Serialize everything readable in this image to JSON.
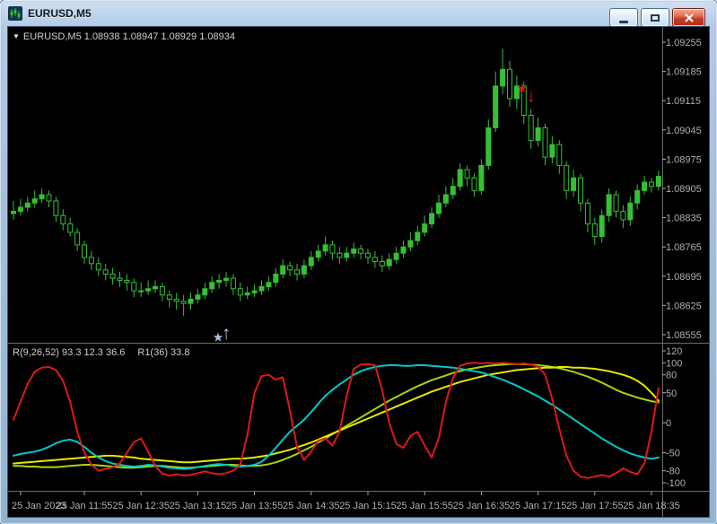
{
  "window": {
    "title": "EURUSD,M5"
  },
  "chart": {
    "ohlc_triangle": "▼",
    "symbol_line": "EURUSD,M5 1.08938 1.08947 1.08929 1.08934",
    "indicator_label_1": "R(9,26,52) 93.3 12.3 36.6",
    "indicator_label_2": "R1(36) 33.8"
  },
  "colors": {
    "background": "#000000",
    "candle": "#35c035",
    "axis_text": "#b0b0b0",
    "separator": "#6e6e6e",
    "up_arrow": "#a6c5e6",
    "down_arrow": "#e01212"
  },
  "chart_data": {
    "type": "candlestick",
    "symbol": "EURUSD",
    "timeframe": "M5",
    "price_axis": [
      1.09255,
      1.09185,
      1.09115,
      1.09045,
      1.08975,
      1.08905,
      1.08835,
      1.08765,
      1.08695,
      1.08625,
      1.08555
    ],
    "time_axis": [
      {
        "index": 1,
        "label": "25 Jan 2023"
      },
      {
        "index": 10,
        "label": "25 Jan 11:55"
      },
      {
        "index": 18,
        "label": "25 Jan 12:35"
      },
      {
        "index": 26,
        "label": "25 Jan 13:15"
      },
      {
        "index": 34,
        "label": "25 Jan 13:55"
      },
      {
        "index": 42,
        "label": "25 Jan 14:35"
      },
      {
        "index": 50,
        "label": "25 Jan 15:15"
      },
      {
        "index": 58,
        "label": "25 Jan 15:55"
      },
      {
        "index": 66,
        "label": "25 Jan 16:35"
      },
      {
        "index": 74,
        "label": "25 Jan 17:15"
      },
      {
        "index": 82,
        "label": "25 Jan 17:55"
      },
      {
        "index": 90,
        "label": "25 Jan 18:35"
      }
    ],
    "candles": [
      [
        1.08845,
        1.08875,
        1.0883,
        1.0885
      ],
      [
        1.0885,
        1.0888,
        1.0884,
        1.0886
      ],
      [
        1.0886,
        1.08885,
        1.0885,
        1.0887
      ],
      [
        1.0887,
        1.089,
        1.0886,
        1.0888
      ],
      [
        1.0888,
        1.08905,
        1.0887,
        1.0889
      ],
      [
        1.0889,
        1.089,
        1.0886,
        1.08875
      ],
      [
        1.08875,
        1.08885,
        1.08825,
        1.0884
      ],
      [
        1.0884,
        1.08855,
        1.08805,
        1.0882
      ],
      [
        1.0882,
        1.08835,
        1.0879,
        1.088
      ],
      [
        1.088,
        1.0881,
        1.08755,
        1.0877
      ],
      [
        1.0877,
        1.0878,
        1.08725,
        1.0874
      ],
      [
        1.0874,
        1.08755,
        1.0871,
        1.08725
      ],
      [
        1.08725,
        1.0874,
        1.08695,
        1.0871
      ],
      [
        1.0871,
        1.08725,
        1.08685,
        1.087
      ],
      [
        1.087,
        1.08715,
        1.08675,
        1.0869
      ],
      [
        1.0869,
        1.08705,
        1.0867,
        1.08685
      ],
      [
        1.08685,
        1.087,
        1.0866,
        1.0868
      ],
      [
        1.0868,
        1.0869,
        1.08645,
        1.0866
      ],
      [
        1.0866,
        1.0868,
        1.08645,
        1.0866
      ],
      [
        1.0866,
        1.08685,
        1.0865,
        1.08665
      ],
      [
        1.08665,
        1.08685,
        1.08655,
        1.0867
      ],
      [
        1.0867,
        1.0868,
        1.08635,
        1.0865
      ],
      [
        1.0865,
        1.0866,
        1.0862,
        1.0864
      ],
      [
        1.0864,
        1.08655,
        1.08615,
        1.08635
      ],
      [
        1.08635,
        1.0865,
        1.086,
        1.0863
      ],
      [
        1.0863,
        1.08655,
        1.08615,
        1.0864
      ],
      [
        1.0864,
        1.08665,
        1.0863,
        1.0865
      ],
      [
        1.0865,
        1.0868,
        1.0864,
        1.08665
      ],
      [
        1.08665,
        1.08695,
        1.08655,
        1.0868
      ],
      [
        1.0868,
        1.087,
        1.08665,
        1.08685
      ],
      [
        1.08685,
        1.08705,
        1.0867,
        1.0869
      ],
      [
        1.0869,
        1.087,
        1.0865,
        1.08665
      ],
      [
        1.08665,
        1.0868,
        1.08635,
        1.0865
      ],
      [
        1.0865,
        1.0867,
        1.0864,
        1.08655
      ],
      [
        1.08655,
        1.08675,
        1.08645,
        1.0866
      ],
      [
        1.0866,
        1.08685,
        1.0865,
        1.0867
      ],
      [
        1.0867,
        1.08695,
        1.0866,
        1.0868
      ],
      [
        1.0868,
        1.08715,
        1.0867,
        1.087
      ],
      [
        1.087,
        1.08735,
        1.0869,
        1.0872
      ],
      [
        1.0872,
        1.0873,
        1.08695,
        1.0871
      ],
      [
        1.0871,
        1.08725,
        1.08685,
        1.087
      ],
      [
        1.087,
        1.08735,
        1.0869,
        1.0872
      ],
      [
        1.0872,
        1.08755,
        1.0871,
        1.0874
      ],
      [
        1.0874,
        1.0877,
        1.0873,
        1.08755
      ],
      [
        1.08755,
        1.0879,
        1.08745,
        1.0877
      ],
      [
        1.0877,
        1.0878,
        1.08735,
        1.0875
      ],
      [
        1.0875,
        1.08765,
        1.08725,
        1.0874
      ],
      [
        1.0874,
        1.08765,
        1.0873,
        1.0875
      ],
      [
        1.0875,
        1.08775,
        1.0874,
        1.0876
      ],
      [
        1.0876,
        1.0877,
        1.08735,
        1.0875
      ],
      [
        1.0875,
        1.0876,
        1.08725,
        1.0874
      ],
      [
        1.0874,
        1.08755,
        1.08715,
        1.0873
      ],
      [
        1.0873,
        1.08745,
        1.08705,
        1.0872
      ],
      [
        1.0872,
        1.0875,
        1.0871,
        1.08735
      ],
      [
        1.08735,
        1.08765,
        1.08725,
        1.0875
      ],
      [
        1.0875,
        1.0878,
        1.0874,
        1.08765
      ],
      [
        1.08765,
        1.088,
        1.08755,
        1.0878
      ],
      [
        1.0878,
        1.08815,
        1.0877,
        1.088
      ],
      [
        1.088,
        1.0884,
        1.0879,
        1.0882
      ],
      [
        1.0882,
        1.0886,
        1.0881,
        1.08845
      ],
      [
        1.08845,
        1.0889,
        1.08835,
        1.0887
      ],
      [
        1.0887,
        1.0891,
        1.0886,
        1.0889
      ],
      [
        1.0889,
        1.0893,
        1.0888,
        1.0891
      ],
      [
        1.0891,
        1.08965,
        1.089,
        1.0895
      ],
      [
        1.0895,
        1.0896,
        1.0891,
        1.0893
      ],
      [
        1.0893,
        1.0894,
        1.08885,
        1.089
      ],
      [
        1.089,
        1.08975,
        1.0889,
        1.0896
      ],
      [
        1.0896,
        1.0907,
        1.0895,
        1.0905
      ],
      [
        1.0905,
        1.09185,
        1.0904,
        1.0915
      ],
      [
        1.0915,
        1.0924,
        1.0913,
        1.0919
      ],
      [
        1.0919,
        1.0921,
        1.091,
        1.0912
      ],
      [
        1.0912,
        1.09175,
        1.09095,
        1.0915
      ],
      [
        1.0915,
        1.0916,
        1.0906,
        1.0908
      ],
      [
        1.0908,
        1.09095,
        1.09,
        1.0902
      ],
      [
        1.0902,
        1.09075,
        1.09005,
        1.0905
      ],
      [
        1.0905,
        1.0906,
        1.0896,
        1.0898
      ],
      [
        1.0898,
        1.0903,
        1.08965,
        1.0901
      ],
      [
        1.0901,
        1.0902,
        1.0894,
        1.0896
      ],
      [
        1.0896,
        1.0897,
        1.0888,
        1.089
      ],
      [
        1.089,
        1.0895,
        1.08885,
        1.0893
      ],
      [
        1.0893,
        1.0894,
        1.0885,
        1.0887
      ],
      [
        1.0887,
        1.0888,
        1.088,
        1.0882
      ],
      [
        1.0882,
        1.08835,
        1.0877,
        1.0879
      ],
      [
        1.0879,
        1.08855,
        1.08775,
        1.0884
      ],
      [
        1.0884,
        1.08905,
        1.08825,
        1.0889
      ],
      [
        1.0889,
        1.089,
        1.08835,
        1.0885
      ],
      [
        1.0885,
        1.08865,
        1.0881,
        1.0883
      ],
      [
        1.0883,
        1.08885,
        1.08815,
        1.0887
      ],
      [
        1.0887,
        1.08915,
        1.08855,
        1.089
      ],
      [
        1.089,
        1.08935,
        1.0889,
        1.0892
      ],
      [
        1.0892,
        1.0893,
        1.08895,
        1.0891
      ],
      [
        1.0891,
        1.08947,
        1.089,
        1.08934
      ]
    ],
    "markers": [
      {
        "name": "buy-signal-arrow",
        "direction": "up",
        "color": "#a6c5e6",
        "index": 30,
        "price": 1.086
      },
      {
        "name": "sell-signal-arrow",
        "direction": "down",
        "color": "#e01212",
        "index": 73,
        "price": 1.09095
      }
    ],
    "indicator": {
      "label": "R(9,26,52)",
      "values_label": "93.3 12.3 36.6",
      "secondary_label": "R1(36) 33.8",
      "levels": [
        120,
        100,
        80,
        50,
        0,
        -50,
        -80,
        -100
      ],
      "series": [
        {
          "name": "r-red",
          "color": "#e01818",
          "values": [
            5,
            35,
            65,
            85,
            92,
            93,
            88,
            70,
            35,
            -15,
            -50,
            -70,
            -80,
            -77,
            -74,
            -68,
            -50,
            -32,
            -26,
            -48,
            -72,
            -85,
            -88,
            -86,
            -88,
            -87,
            -84,
            -81,
            -84,
            -86,
            -84,
            -80,
            -70,
            -20,
            50,
            78,
            80,
            72,
            76,
            20,
            -40,
            -62,
            -48,
            -30,
            -26,
            -38,
            -15,
            45,
            90,
            97,
            98,
            96,
            55,
            0,
            -35,
            -42,
            -22,
            -15,
            -38,
            -58,
            -25,
            35,
            75,
            95,
            99,
            100,
            99,
            100,
            99,
            100,
            99,
            98,
            99,
            97,
            94,
            80,
            40,
            -10,
            -55,
            -80,
            -90,
            -92,
            -90,
            -87,
            -90,
            -84,
            -76,
            -82,
            -86,
            -68,
            -15,
            58
          ]
        },
        {
          "name": "r-cyan",
          "color": "#00c8c8",
          "values": [
            -55,
            -52,
            -50,
            -48,
            -45,
            -40,
            -34,
            -30,
            -28,
            -32,
            -40,
            -50,
            -58,
            -64,
            -68,
            -70,
            -72,
            -73,
            -72,
            -70,
            -71,
            -73,
            -75,
            -76,
            -77,
            -76,
            -74,
            -72,
            -70,
            -69,
            -70,
            -72,
            -73,
            -72,
            -70,
            -65,
            -55,
            -42,
            -28,
            -15,
            -5,
            5,
            18,
            32,
            45,
            55,
            64,
            72,
            80,
            86,
            90,
            93,
            95,
            96,
            96,
            95,
            95,
            96,
            96,
            95,
            94,
            93,
            92,
            90,
            88,
            86,
            84,
            80,
            76,
            72,
            67,
            62,
            56,
            50,
            44,
            37,
            30,
            22,
            14,
            6,
            -2,
            -10,
            -18,
            -26,
            -33,
            -40,
            -46,
            -51,
            -55,
            -58,
            -60,
            -58
          ]
        },
        {
          "name": "r-yellow",
          "color": "#e8e800",
          "values": [
            -68,
            -67,
            -66,
            -65,
            -64,
            -63,
            -62,
            -61,
            -60,
            -59,
            -58,
            -57,
            -56,
            -55,
            -55,
            -56,
            -57,
            -58,
            -60,
            -61,
            -62,
            -63,
            -64,
            -65,
            -66,
            -66,
            -65,
            -64,
            -63,
            -62,
            -61,
            -60,
            -60,
            -59,
            -58,
            -56,
            -54,
            -51,
            -48,
            -45,
            -41,
            -37,
            -33,
            -28,
            -23,
            -18,
            -13,
            -8,
            -3,
            2,
            7,
            12,
            17,
            22,
            27,
            32,
            37,
            42,
            47,
            52,
            56,
            60,
            64,
            68,
            71,
            74,
            77,
            80,
            82,
            84,
            86,
            88,
            89,
            90,
            91,
            92,
            92,
            93,
            93,
            92,
            92,
            91,
            90,
            88,
            86,
            83,
            80,
            76,
            70,
            62,
            50,
            37
          ]
        },
        {
          "name": "r1-yellowgreen",
          "color": "#a8d608",
          "values": [
            -72,
            -72,
            -73,
            -73,
            -74,
            -74,
            -74,
            -73,
            -72,
            -71,
            -70,
            -70,
            -71,
            -72,
            -73,
            -74,
            -75,
            -75,
            -74,
            -73,
            -72,
            -72,
            -73,
            -74,
            -75,
            -75,
            -74,
            -73,
            -72,
            -71,
            -70,
            -70,
            -71,
            -72,
            -72,
            -71,
            -69,
            -66,
            -62,
            -57,
            -52,
            -46,
            -40,
            -33,
            -26,
            -19,
            -12,
            -5,
            2,
            9,
            16,
            23,
            30,
            37,
            43,
            49,
            55,
            61,
            66,
            71,
            75,
            79,
            83,
            86,
            89,
            91,
            93,
            95,
            96,
            97,
            98,
            98,
            98,
            97,
            96,
            95,
            93,
            91,
            88,
            85,
            81,
            77,
            72,
            67,
            61,
            55,
            50,
            46,
            42,
            39,
            36,
            34
          ]
        }
      ]
    }
  }
}
